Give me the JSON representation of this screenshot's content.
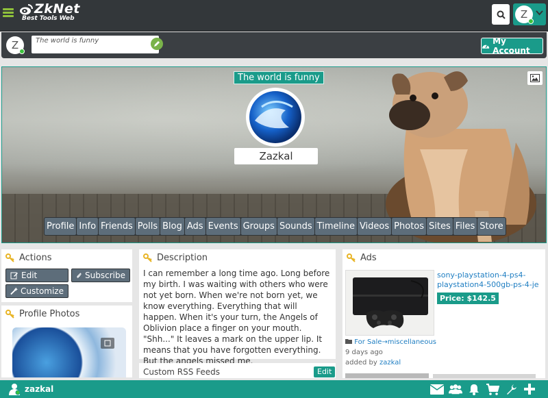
{
  "header": {
    "brand": "ZkNet",
    "tagline": "Best Tools Web",
    "account_initial": "Z"
  },
  "statusbar": {
    "avatar_initial": "Z",
    "status_text": "The world is funny",
    "my_account_label": "My Account"
  },
  "cover": {
    "title": "The world is funny",
    "name": "Zazkal",
    "tabs": [
      "Profile",
      "Info",
      "Friends",
      "Polls",
      "Blog",
      "Ads",
      "Events",
      "Groups",
      "Sounds",
      "Timeline",
      "Videos",
      "Photos",
      "Sites",
      "Files",
      "Store"
    ]
  },
  "actions": {
    "title": "Actions",
    "edit_label": "Edit",
    "subscribe_label": "Subscribe",
    "customize_label": "Customize"
  },
  "photos": {
    "title": "Profile Photos"
  },
  "description": {
    "title": "Description",
    "text": "I can remember a long time ago. Long before my birth. I was waiting with others who were not yet born. When we're not born yet, we know everything. Everything that will happen. When it's your turn, the Angels of Oblivion place a finger on your mouth. \"Shh...\" It leaves a mark on the upper lip. It means that you have forgotten everything. But the angels missed me."
  },
  "rss": {
    "title": "Custom RSS Feeds",
    "edit_label": "Edit"
  },
  "ads": {
    "title": "Ads",
    "item": {
      "title": "sony-playstation-4-ps4-playstation4-500gb-ps-4-je",
      "price": "Price: $142.5",
      "category": "For Sale→miscellaneous",
      "time": "9 days ago",
      "added_by_prefix": "added by",
      "added_by_user": "zazkal"
    }
  },
  "bottombar": {
    "username": "zazkal"
  },
  "colors": {
    "accent": "#1a9b8a",
    "topbar": "#33373a",
    "tab": "#5d6d7a",
    "link": "#1f7ec2"
  }
}
